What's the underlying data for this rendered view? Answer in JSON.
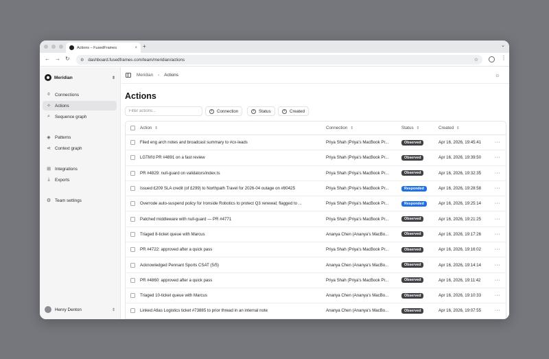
{
  "browser": {
    "tab_title": "Actions – FusedFrames",
    "tab_close": "×",
    "new_tab": "+",
    "url": "dashboard.fusedframes.com/team/meridian/actions"
  },
  "sidebar": {
    "org_name": "Meridian",
    "items": [
      {
        "label": "Connections",
        "icon": "plug-icon"
      },
      {
        "label": "Actions",
        "icon": "sparkle-icon",
        "active": true
      },
      {
        "label": "Sequence graph",
        "icon": "search-graph-icon"
      },
      {
        "label": "Patterns",
        "icon": "layers-icon"
      },
      {
        "label": "Context graph",
        "icon": "share-icon"
      },
      {
        "label": "Integrations",
        "icon": "puzzle-icon"
      },
      {
        "label": "Exports",
        "icon": "download-icon"
      },
      {
        "label": "Team settings",
        "icon": "gear-icon"
      }
    ],
    "user_name": "Henry Denton"
  },
  "breadcrumb": {
    "root": "Meridian",
    "current": "Actions"
  },
  "page_title": "Actions",
  "filters": {
    "search_placeholder": "Filter actions...",
    "chips": [
      "Connection",
      "Status",
      "Created"
    ]
  },
  "table": {
    "columns": {
      "action": "Action",
      "connection": "Connection",
      "status": "Status",
      "created": "Created"
    },
    "rows": [
      {
        "action": "Filed eng arch notes and broadcast summary to #cx-leads",
        "connection": "Priya Shah (Priya's MacBook Pr...",
        "status": "Observed",
        "created": "Apr 16, 2026, 19:45:41"
      },
      {
        "action": "LGTM'd PR #4891 on a fast review",
        "connection": "Priya Shah (Priya's MacBook Pr...",
        "status": "Observed",
        "created": "Apr 16, 2026, 19:39:50"
      },
      {
        "action": "PR #4829: null-guard on validators/index.ts",
        "connection": "Priya Shah (Priya's MacBook Pr...",
        "status": "Observed",
        "created": "Apr 16, 2026, 19:32:35"
      },
      {
        "action": "Issued £209 SLA credit (of £299) to Northpath Travel for 2026-04 outage on #80425",
        "connection": "Priya Shah (Priya's MacBook Pr...",
        "status": "Responded",
        "created": "Apr 16, 2026, 19:28:58"
      },
      {
        "action": "Overrode auto-suspend policy for Ironside Robotics to protect Q3 renewal; flagged to ...",
        "connection": "Priya Shah (Priya's MacBook Pr...",
        "status": "Responded",
        "created": "Apr 16, 2026, 19:25:14"
      },
      {
        "action": "Patched middleware with null-guard — PR #4771",
        "connection": "Priya Shah (Priya's MacBook Pr...",
        "status": "Observed",
        "created": "Apr 16, 2026, 19:21:25"
      },
      {
        "action": "Triaged 8-ticket queue with Marcus",
        "connection": "Ananya Chen (Ananya's MacBo...",
        "status": "Observed",
        "created": "Apr 16, 2026, 19:17:26"
      },
      {
        "action": "PR #4722: approved after a quick pass",
        "connection": "Priya Shah (Priya's MacBook Pr...",
        "status": "Observed",
        "created": "Apr 16, 2026, 19:16:02"
      },
      {
        "action": "Acknowledged Pennant Sports CSAT (5/5)",
        "connection": "Ananya Chen (Ananya's MacBo...",
        "status": "Observed",
        "created": "Apr 16, 2026, 19:14:14"
      },
      {
        "action": "PR #4860: approved after a quick pass",
        "connection": "Priya Shah (Priya's MacBook Pr...",
        "status": "Observed",
        "created": "Apr 16, 2026, 19:11:42"
      },
      {
        "action": "Triaged 10-ticket queue with Marcus",
        "connection": "Ananya Chen (Ananya's MacBo...",
        "status": "Observed",
        "created": "Apr 16, 2026, 19:10:33"
      },
      {
        "action": "Linked Atlas Logistics ticket #73885 to prior thread in an internal note",
        "connection": "Ananya Chen (Ananya's MacBo...",
        "status": "Observed",
        "created": "Apr 16, 2026, 19:07:55"
      }
    ]
  },
  "colors": {
    "observed": "#3f4146",
    "responded": "#1f6fe5"
  }
}
